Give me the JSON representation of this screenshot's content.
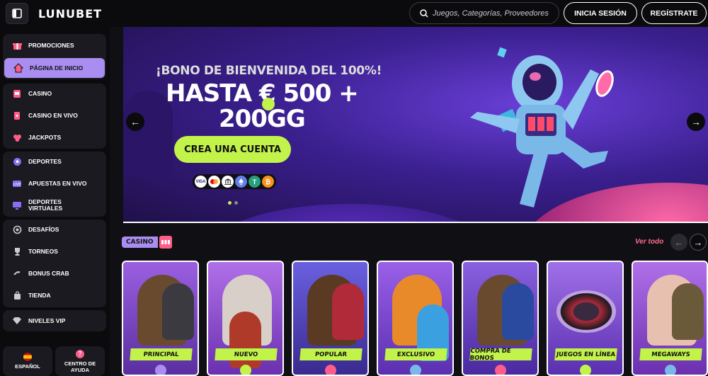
{
  "header": {
    "logo": "LUNUBET",
    "search_placeholder": "Juegos, Categorías, Proveedores",
    "login_label": "INICIA SESIÓN",
    "register_label": "REGÍSTRATE"
  },
  "sidebar": {
    "items": [
      {
        "label": "PROMOCIONES",
        "icon": "gift-icon"
      },
      {
        "label": "PÁGINA DE INICIO",
        "icon": "home-icon"
      },
      {
        "label": "CASINO",
        "icon": "slot-machine-icon"
      },
      {
        "label": "CASINO EN VIVO",
        "icon": "cards-icon"
      },
      {
        "label": "JACKPOTS",
        "icon": "clover-icon"
      },
      {
        "label": "DEPORTES",
        "icon": "soccer-ball-icon"
      },
      {
        "label": "APUESTAS EN VIVO",
        "icon": "live-icon"
      },
      {
        "label": "DEPORTES VIRTUALES",
        "icon": "monitor-icon"
      },
      {
        "label": "DESAFÍOS",
        "icon": "target-icon"
      },
      {
        "label": "TORNEOS",
        "icon": "trophy-icon"
      },
      {
        "label": "BONUS CRAB",
        "icon": "crab-icon"
      },
      {
        "label": "TIENDA",
        "icon": "bag-icon"
      },
      {
        "label": "NIVELES VIP",
        "icon": "diamond-icon"
      }
    ],
    "language_label": "ESPAÑOL",
    "help_label": "CENTRO DE AYUDA"
  },
  "banner": {
    "subtitle": "¡BONO DE BIENVENIDA DEL 100%!",
    "title_line1": "HASTA € 500 +",
    "title_line2": "200GG",
    "cta_label": "CREA UNA CUENTA",
    "payment_methods": [
      "VISA",
      "MC",
      "BANK",
      "ETH",
      "USDT",
      "BTC"
    ],
    "slide_index": 1,
    "slide_count": 2
  },
  "casino_section": {
    "title": "CASINO",
    "view_all": "Ver todo",
    "cards": [
      {
        "label": "PRINCIPAL"
      },
      {
        "label": "NUEVO"
      },
      {
        "label": "POPULAR"
      },
      {
        "label": "EXCLUSIVO"
      },
      {
        "label": "COMPRA DE BONOS"
      },
      {
        "label": "JUEGOS EN LÍNEA"
      },
      {
        "label": "MEGAWAYS"
      }
    ]
  },
  "colors": {
    "accent_lime": "#c2f34a",
    "accent_purple": "#a98df0",
    "link_pink": "#ff6a8e",
    "background": "#101014"
  }
}
